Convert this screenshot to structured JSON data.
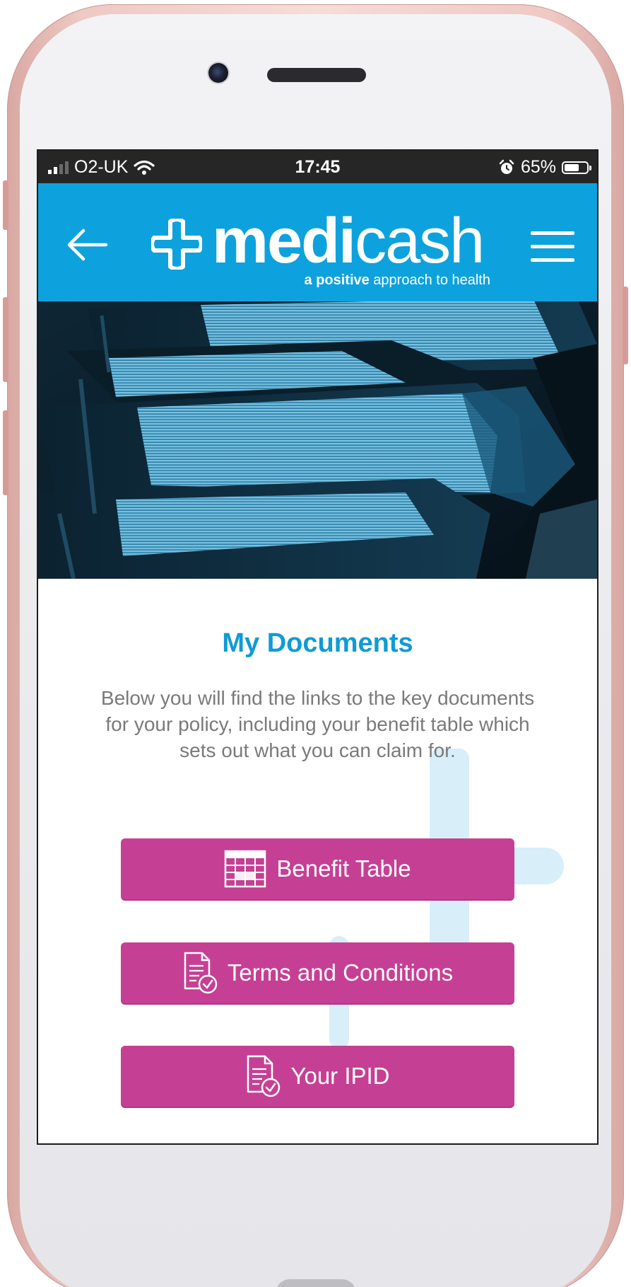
{
  "status_bar": {
    "carrier": "O2-UK",
    "time": "17:45",
    "battery_percent_text": "65%",
    "battery_level": 0.65
  },
  "header": {
    "brand_bold": "medi",
    "brand_light": "cash",
    "tagline_bold": "a positive",
    "tagline_rest": " approach to health",
    "background_color": "#0da2dd"
  },
  "hero": {
    "image": "stacked-blue-folders-photo"
  },
  "main": {
    "title": "My Documents",
    "intro": "Below you will find the links to the key documents for your policy, including your benefit table which sets out what you can claim for.",
    "buttons": [
      {
        "label": "Benefit Table",
        "icon": "table-icon"
      },
      {
        "label": "Terms and Conditions",
        "icon": "document-check-icon"
      },
      {
        "label": "Your IPID",
        "icon": "document-check-icon"
      }
    ]
  },
  "colors": {
    "accent_blue": "#0f9bd6",
    "button_magenta": "#c54094",
    "body_text": "#7a7a7a"
  }
}
